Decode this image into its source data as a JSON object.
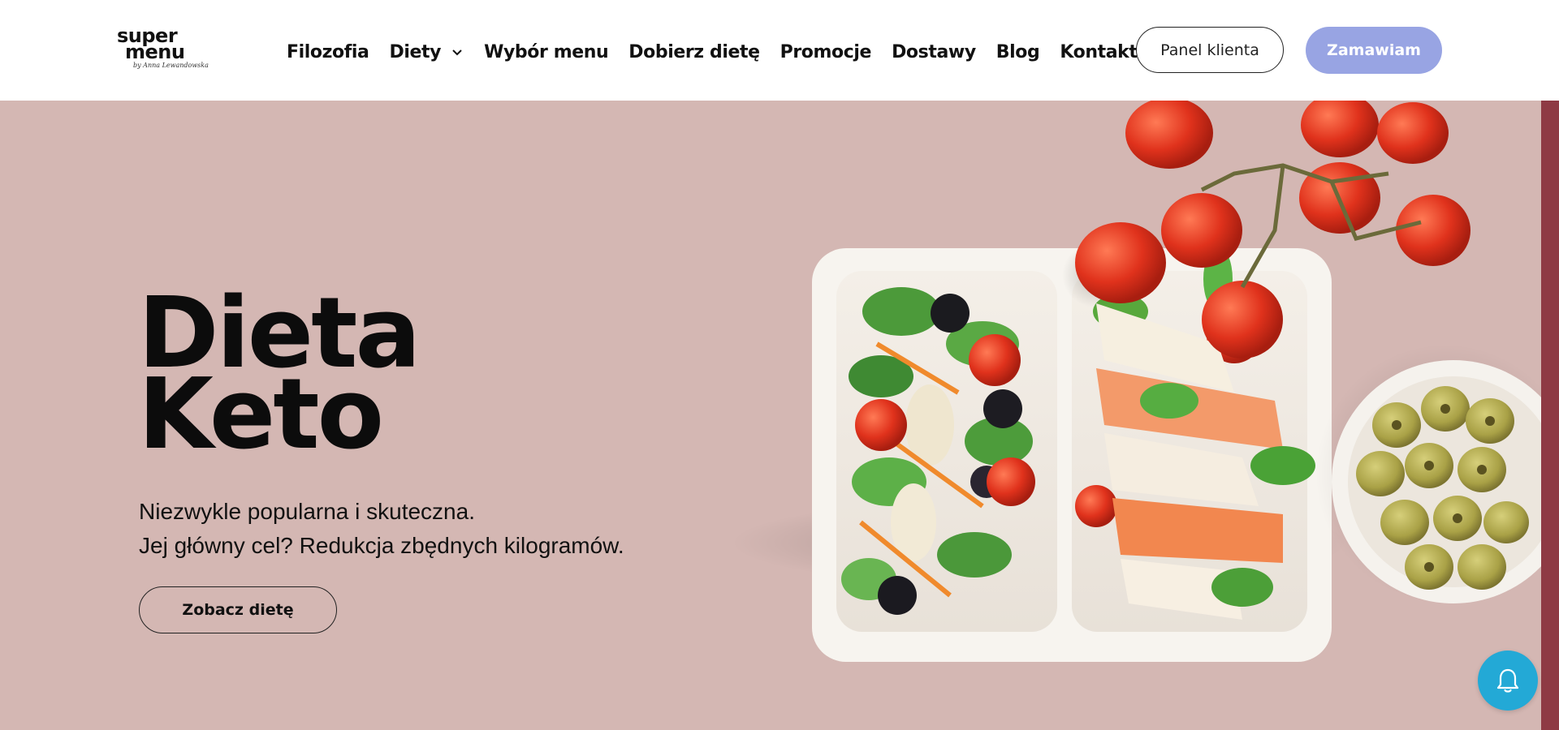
{
  "header": {
    "logo": {
      "line1": "super",
      "line2": "menu",
      "signature": "by Anna Lewandowska"
    },
    "nav": [
      {
        "label": "Filozofia"
      },
      {
        "label": "Diety",
        "has_dropdown": true
      },
      {
        "label": "Wybór menu"
      },
      {
        "label": "Dobierz dietę"
      },
      {
        "label": "Promocje"
      },
      {
        "label": "Dostawy"
      },
      {
        "label": "Blog"
      },
      {
        "label": "Kontakt"
      }
    ],
    "panel_label": "Panel klienta",
    "order_label": "Zamawiam"
  },
  "hero": {
    "title_line1": "Dieta",
    "title_line2": "Keto",
    "subtitle_line1": "Niezwykle popularna i skuteczna.",
    "subtitle_line2": "Jej główny cel? Redukcja zbędnych kilogramów.",
    "cta_label": "Zobacz dietę"
  },
  "icons": {
    "dropdown": "chevron-down-icon",
    "notification": "bell-icon"
  },
  "colors": {
    "hero_bg": "#d4b7b3",
    "order_button": "#98a4e3",
    "accent_strip": "#8e3a44",
    "notification_button": "#23a9d6"
  }
}
